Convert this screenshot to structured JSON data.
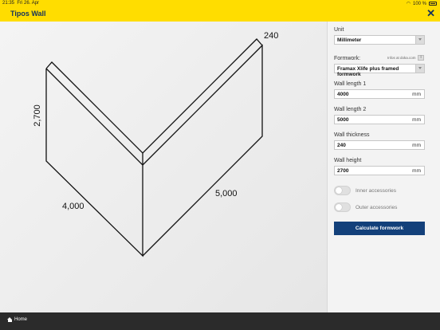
{
  "status": {
    "time": "21:35",
    "date": "Fri 26. Apr",
    "battery": "100 %"
  },
  "title": "Tipos Wall",
  "drawing": {
    "dim_top": "240",
    "dim_height": "2,700",
    "dim_left": "4,000",
    "dim_right": "5,000"
  },
  "panel": {
    "unit_label": "Unit",
    "unit_value": "Millimeter",
    "formwork_label": "Formwork:",
    "formwork_info": "Infos at doka.com",
    "formwork_value": "Framax Xlife plus framed formwork",
    "wall_length1_label": "Wall length 1",
    "wall_length1_value": "4000",
    "wall_length1_unit": "mm",
    "wall_length2_label": "Wall length 2",
    "wall_length2_value": "5000",
    "wall_length2_unit": "mm",
    "wall_thickness_label": "Wall thickness",
    "wall_thickness_value": "240",
    "wall_thickness_unit": "mm",
    "wall_height_label": "Wall height",
    "wall_height_value": "2700",
    "wall_height_unit": "mm",
    "inner_accessories": "Inner accessories",
    "outer_accessories": "Outer accessories",
    "calculate": "Calculate formwork"
  },
  "footer": {
    "home": "Home"
  },
  "colors": {
    "brand_yellow": "#ffdd00",
    "brand_blue": "#13407a",
    "dark_bar": "#2b2b2b"
  }
}
